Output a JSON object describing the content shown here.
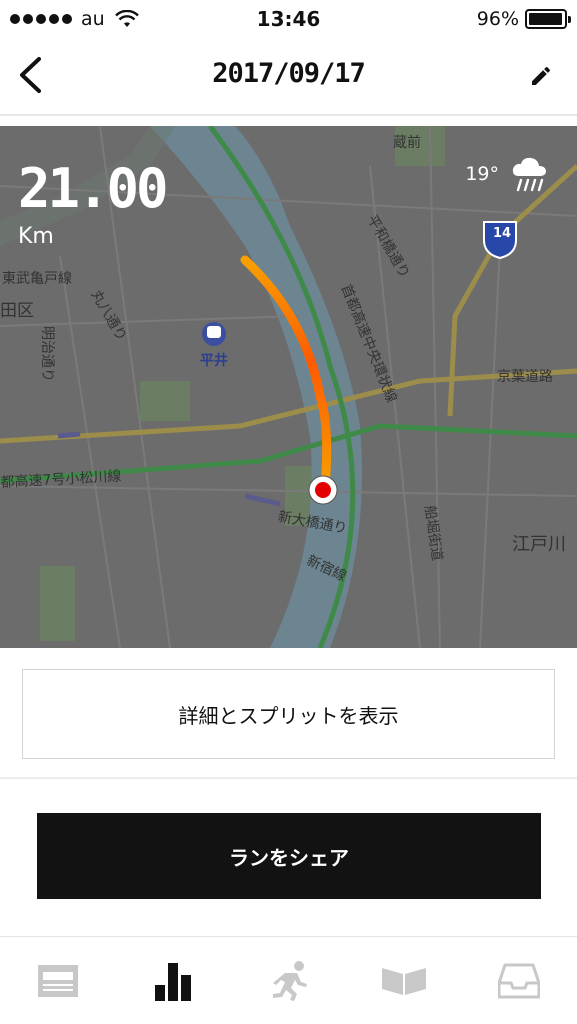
{
  "status_bar": {
    "carrier": "au",
    "time": "13:46",
    "battery": "96%",
    "battery_level": 0.96
  },
  "nav": {
    "title": "2017/09/17",
    "back_icon": "chevron-left-icon",
    "edit_icon": "pencil-icon"
  },
  "run": {
    "distance_value": "21.00",
    "distance_unit": "Km",
    "temperature": "19°",
    "weather_icon": "rain-cloud-icon"
  },
  "map": {
    "route_colors": [
      "#f7a000",
      "#ff5a00"
    ],
    "labels": {
      "kuramae": "蔵前",
      "heiwabashi": "平和橋通り",
      "route14": "14",
      "higashi_kameido": "東武亀戸線",
      "ku": "田区",
      "maruhachi": "丸八通り",
      "meiji": "明治通り",
      "hirai": "平井",
      "shuto_chuo": "首都高速中央環状線",
      "keiyo": "京葉道路",
      "komatsugawa": "都高速7号小松川線",
      "shinohashi": "新大橋通り",
      "shinjuku_line": "新宿線",
      "funabori": "船堀街道",
      "edogawa": "江戸川"
    }
  },
  "actions": {
    "details_label": "詳細とスプリットを表示",
    "share_label": "ランをシェア"
  },
  "tabs": [
    {
      "name": "feed",
      "icon": "newspaper-icon",
      "active": false
    },
    {
      "name": "activity",
      "icon": "bar-chart-icon",
      "active": true
    },
    {
      "name": "run",
      "icon": "runner-icon",
      "active": false
    },
    {
      "name": "plans",
      "icon": "open-book-icon",
      "active": false
    },
    {
      "name": "inbox",
      "icon": "inbox-tray-icon",
      "active": false
    }
  ],
  "colors": {
    "active_tab": "#111111",
    "inactive_tab": "#c8c8c8",
    "share_bg": "#121212"
  }
}
